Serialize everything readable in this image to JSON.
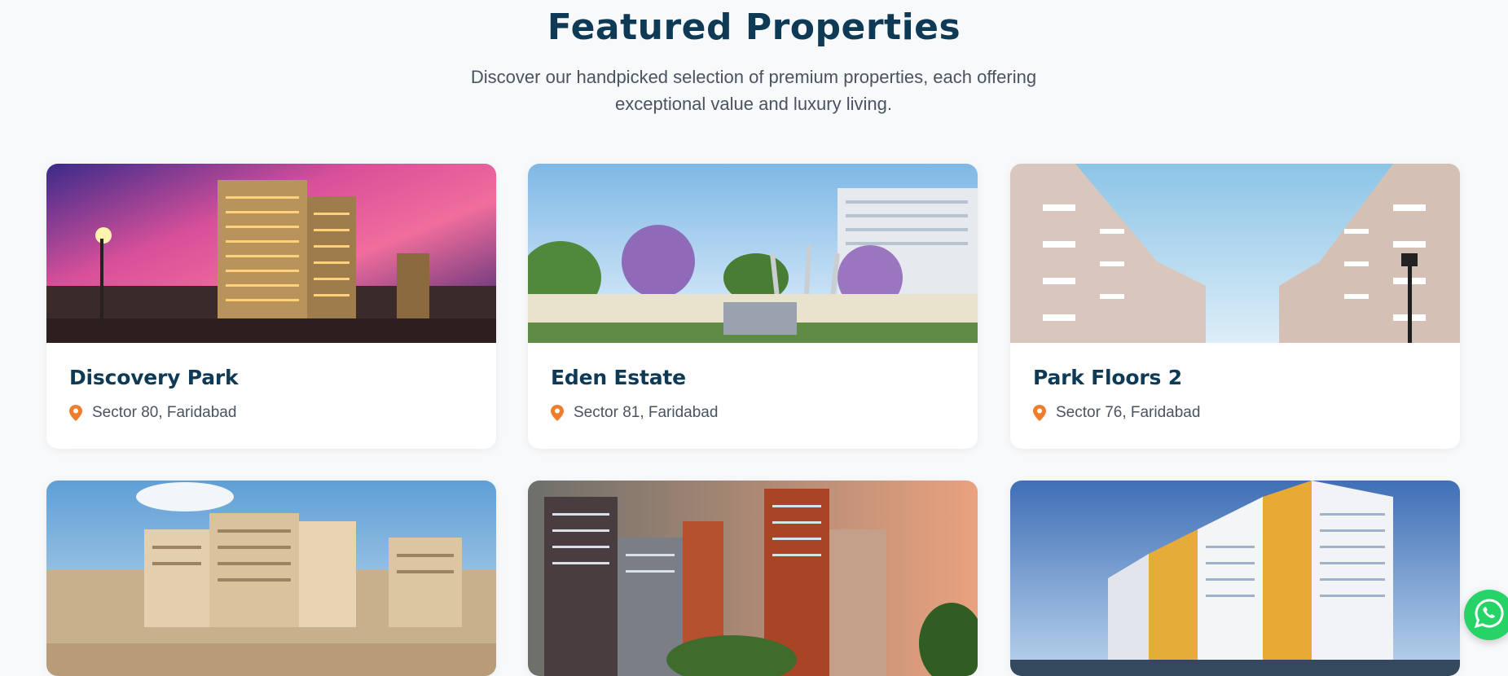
{
  "section": {
    "title": "Featured Properties",
    "subtitle": "Discover our handpicked selection of premium properties, each offering exceptional value and luxury living."
  },
  "properties": [
    {
      "name": "Discovery Park",
      "location": "Sector 80, Faridabad"
    },
    {
      "name": "Eden Estate",
      "location": "Sector 81, Faridabad"
    },
    {
      "name": "Park Floors 2",
      "location": "Sector 76, Faridabad"
    }
  ],
  "colors": {
    "heading": "#0e3a55",
    "pin": "#f07d2b",
    "whatsapp": "#25d366",
    "background": "#f7f9fb"
  },
  "icons": {
    "location": "map-pin-icon",
    "whatsapp": "whatsapp-icon"
  }
}
